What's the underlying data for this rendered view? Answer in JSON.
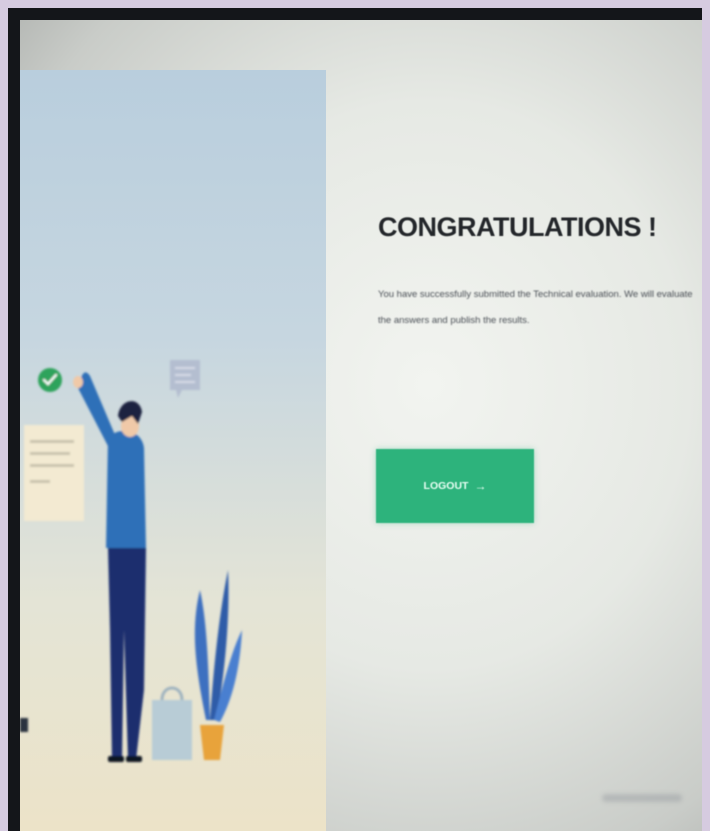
{
  "congrats": {
    "heading": "CONGRATULATIONS !",
    "message": "You have successfully submitted the Technical evaluation. We will evaluate the answers and publish the results.",
    "logout_label": "LOGOUT",
    "logout_arrow": "→"
  },
  "icons": {
    "check": "check-circle-icon",
    "arrow": "arrow-right-icon"
  },
  "colors": {
    "accent": "#2db37c",
    "heading": "#23262a",
    "illustration_panel": "#c3d4de",
    "figure_shirt": "#2f6fb8",
    "figure_pants": "#1c2f6e",
    "plant": "#3e6fc0"
  }
}
